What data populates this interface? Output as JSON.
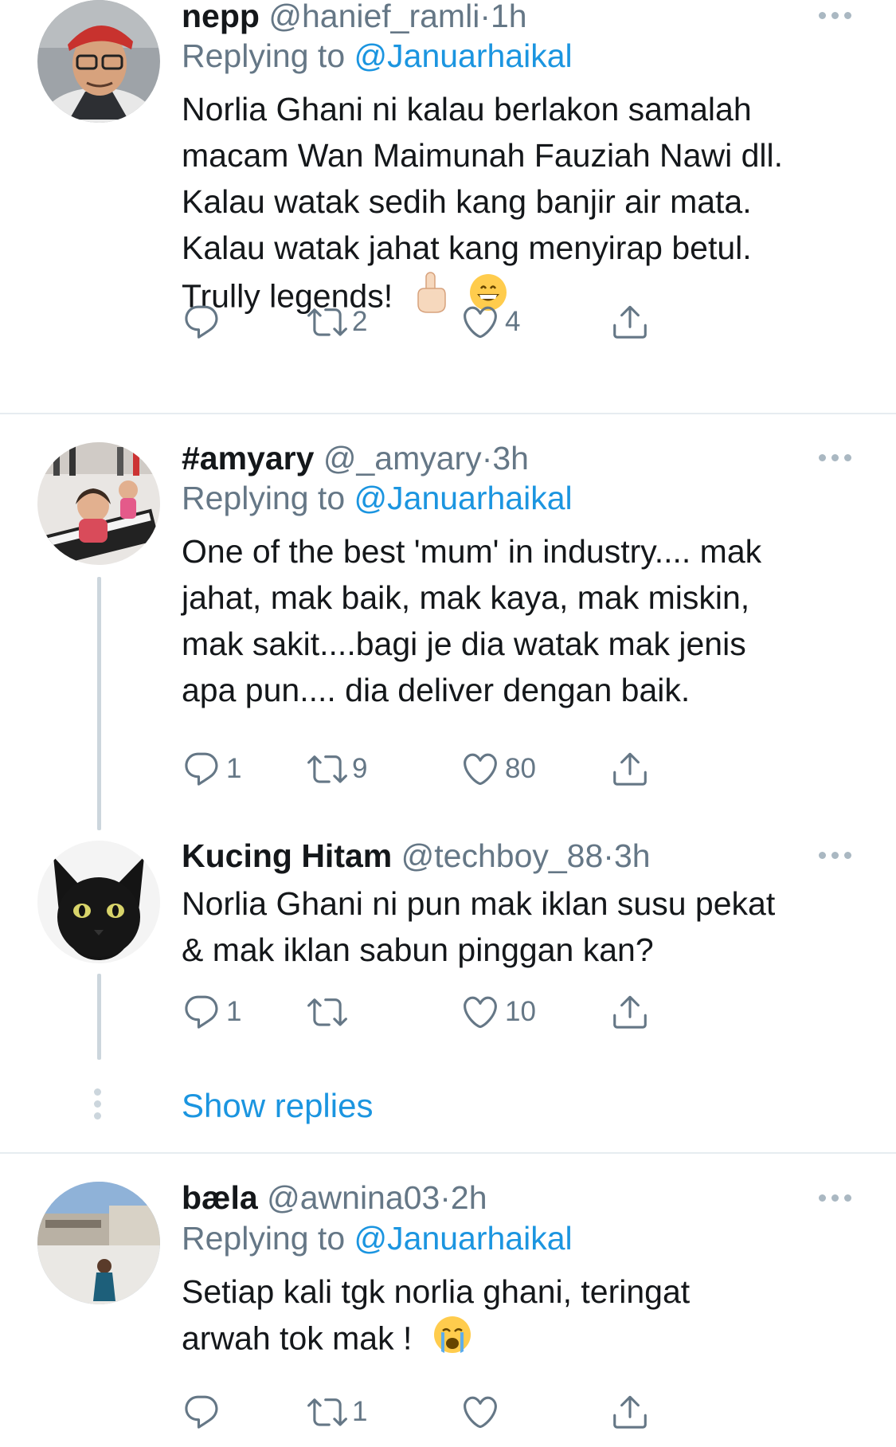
{
  "tweets": [
    {
      "name": "nepp",
      "handle": "@hanief_ramli",
      "dot": "·",
      "time": "1h",
      "replying_prefix": "Replying to ",
      "replying_to": "@Januarhaikal",
      "text_lines": [
        "Norlia Ghani ni kalau berlakon samalah",
        "macam Wan Maimunah Fauziah Nawi dll.",
        "Kalau watak sedih kang banjir air mata.",
        "Kalau watak jahat kang menyirap betul.",
        "Trully legends!"
      ],
      "emojis": [
        "pointing-up-emoji",
        "grinning-emoji"
      ],
      "stats": {
        "replies": "",
        "retweets": "2",
        "likes": "4"
      }
    },
    {
      "name": "#amyary",
      "handle": "@_amyary",
      "dot": "·",
      "time": "3h",
      "replying_prefix": "Replying to ",
      "replying_to": "@Januarhaikal",
      "text_lines": [
        "One of the best 'mum' in industry.... mak",
        "jahat, mak baik, mak kaya, mak miskin,",
        "mak sakit....bagi je dia watak mak jenis",
        "apa pun.... dia deliver dengan baik."
      ],
      "stats": {
        "replies": "1",
        "retweets": "9",
        "likes": "80"
      }
    },
    {
      "name": "Kucing Hitam",
      "handle": "@techboy_88",
      "dot": "·",
      "time": "3h",
      "text_lines": [
        "Norlia Ghani ni pun mak iklan susu pekat",
        "& mak iklan sabun pinggan kan?"
      ],
      "stats": {
        "replies": "1",
        "retweets": "",
        "likes": "10"
      }
    },
    {
      "name": "bæla",
      "handle": "@awnina03",
      "dot": "·",
      "time": "2h",
      "replying_prefix": "Replying to ",
      "replying_to": "@Januarhaikal",
      "text_lines": [
        "Setiap kali tgk norlia ghani, teringat",
        "arwah tok mak !"
      ],
      "emojis": [
        "crying-emoji"
      ],
      "stats": {
        "replies": "",
        "retweets": "1",
        "likes": ""
      }
    }
  ],
  "show_replies": "Show replies",
  "colors": {
    "link": "#1b95e0",
    "secondary": "#657786",
    "divider": "#e6ecf0",
    "thread": "#ccd6dd"
  }
}
